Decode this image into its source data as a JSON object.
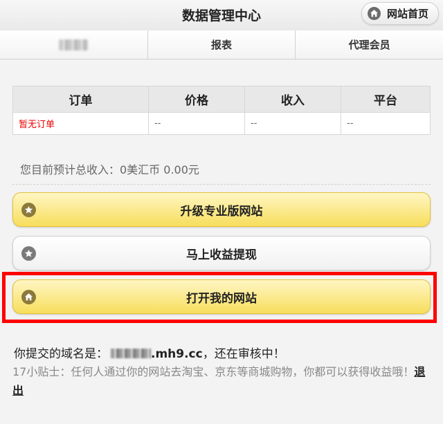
{
  "header": {
    "title": "数据管理中心",
    "home_button_label": "网站首页"
  },
  "nav": {
    "tabs": [
      {
        "label": "",
        "redacted": true
      },
      {
        "label": "报表"
      },
      {
        "label": "代理会员"
      }
    ]
  },
  "orders_table": {
    "headers": [
      "订单",
      "价格",
      "收入",
      "平台"
    ],
    "rows": [
      [
        "暂无订单",
        "--",
        "--",
        "--"
      ]
    ]
  },
  "income_text": "您目前预计总收入：0美汇币 0.00元",
  "buttons": {
    "upgrade": "升级专业版网站",
    "withdraw": "马上收益提现",
    "open_site": "打开我的网站"
  },
  "domain_info": {
    "prefix": "你提交的域名是：",
    "domain_suffix": ".mh9.cc",
    "status": "，还在审核中！"
  },
  "tip": {
    "text": "17小贴士：任何人通过你的网站去淘宝、京东等商城购物，你都可以获得收益哦！",
    "logout_label": "退出"
  },
  "colors": {
    "highlight_border": "#ff0000",
    "button_yellow": "#f7de5c",
    "no_orders_text": "#ee0000"
  },
  "icons": {
    "home": "home-icon",
    "star": "star-icon"
  }
}
